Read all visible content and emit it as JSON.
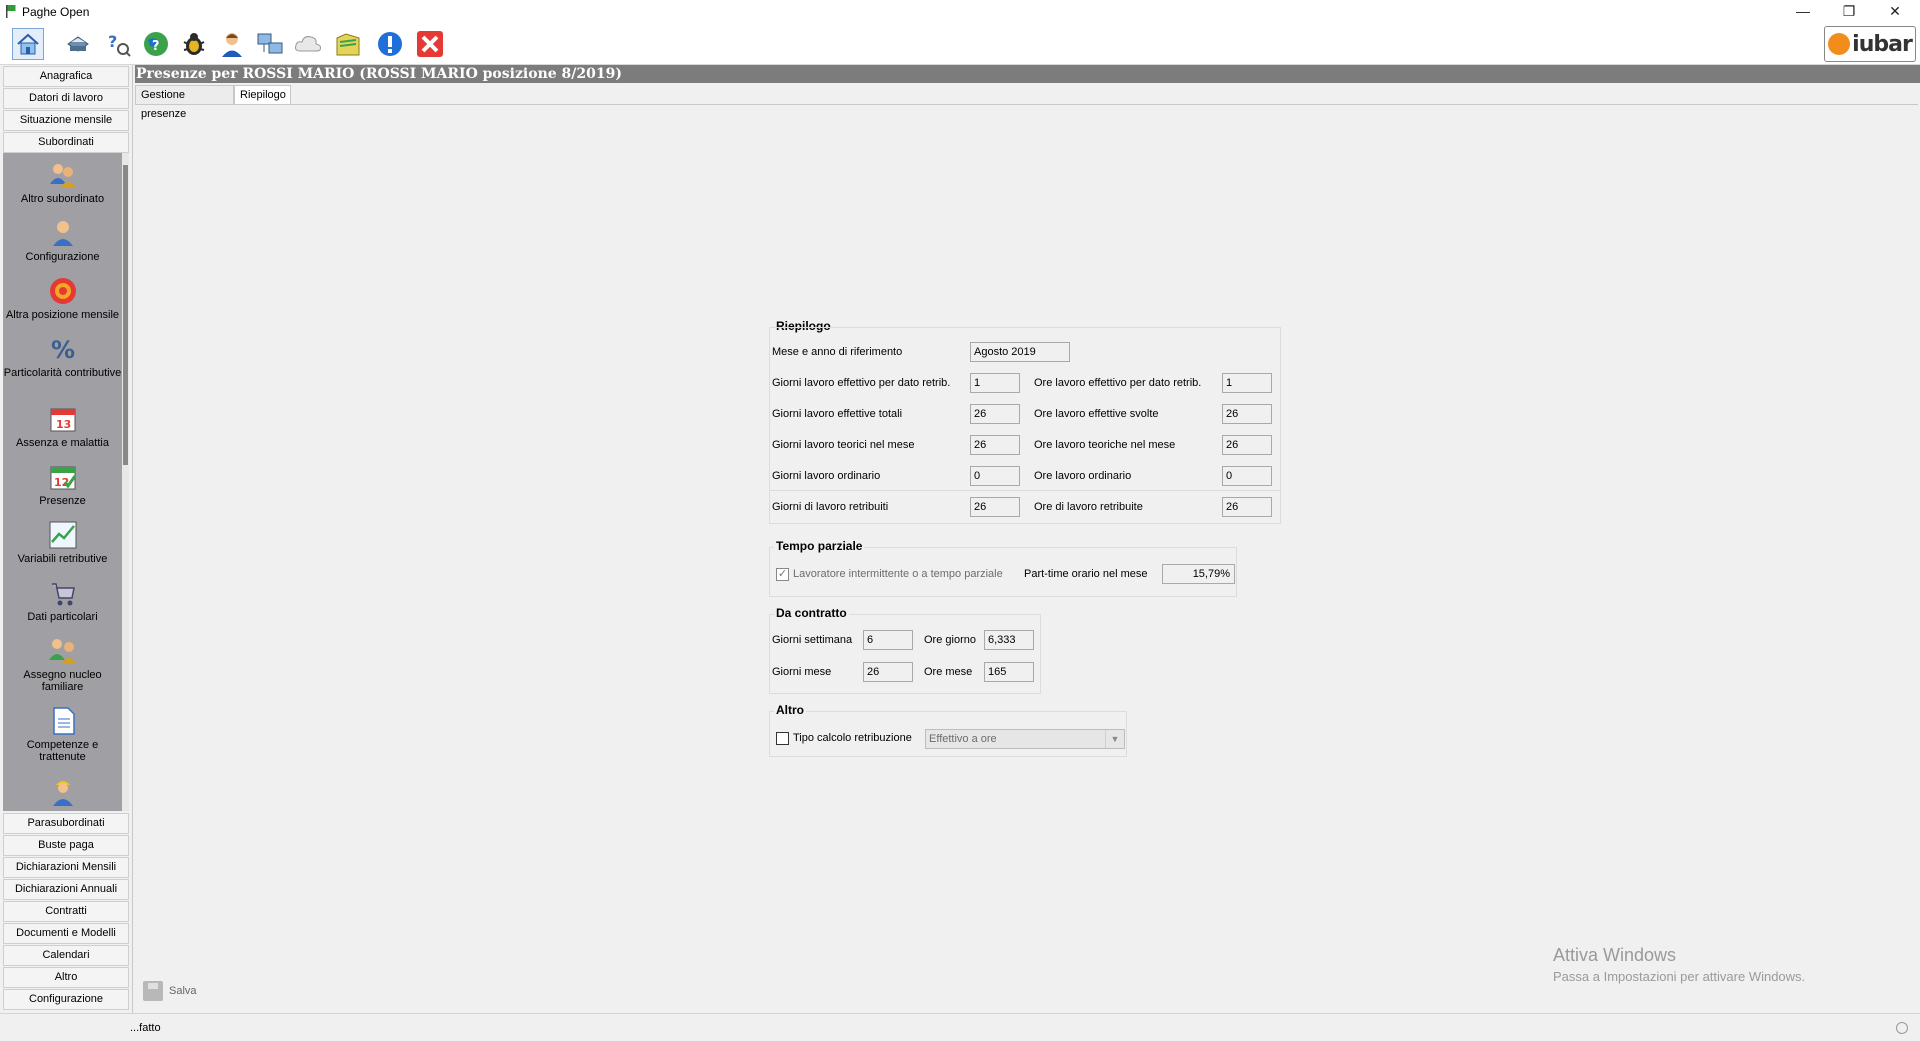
{
  "window": {
    "title": "Paghe Open",
    "controls": [
      "—",
      "❐",
      "✕"
    ]
  },
  "toolbar": {
    "logo_text": "iubar"
  },
  "sidebar": {
    "top_headers": [
      "Anagrafica",
      "Datori di lavoro",
      "Situazione mensile",
      "Subordinati"
    ],
    "items": [
      "Altro subordinato",
      "Configurazione",
      "Altra posizione mensile",
      "Particolarità contributive",
      "Assenza e malattia",
      "Presenze",
      "Variabili retributive",
      "Dati particolari",
      "Assegno nucleo familiare",
      "Competenze e trattenute"
    ],
    "bottom_headers": [
      "Parasubordinati",
      "Buste paga",
      "Dichiarazioni Mensili",
      "Dichiarazioni Annuali",
      "Contratti",
      "Documenti e Modelli",
      "Calendari",
      "Altro",
      "Configurazione"
    ]
  },
  "main": {
    "title": "Presenze per ROSSI MARIO (ROSSI MARIO posizione 8/2019)",
    "tabs": [
      "Gestione presenze",
      "Riepilogo"
    ],
    "active_tab": "Riepilogo",
    "riepilogo": {
      "title": "Riepilogo",
      "mese_label": "Mese e anno di riferimento",
      "mese_value": "Agosto 2019",
      "rows": [
        {
          "left_label": "Giorni lavoro effettivo per dato retrib.",
          "left_value": "1",
          "right_label": "Ore lavoro effettivo per dato retrib.",
          "right_value": "1"
        },
        {
          "left_label": "Giorni lavoro effettive totali",
          "left_value": "26",
          "right_label": "Ore lavoro effettive svolte",
          "right_value": "26"
        },
        {
          "left_label": "Giorni lavoro teorici nel mese",
          "left_value": "26",
          "right_label": "Ore lavoro teoriche nel mese",
          "right_value": "26"
        },
        {
          "left_label": "Giorni lavoro ordinario",
          "left_value": "0",
          "right_label": "Ore lavoro ordinario",
          "right_value": "0"
        },
        {
          "left_label": "Giorni di lavoro retribuiti",
          "left_value": "26",
          "right_label": "Ore di lavoro retribuite",
          "right_value": "26"
        }
      ]
    },
    "tempo_parziale": {
      "title": "Tempo parziale",
      "checkbox_label": "Lavoratore intermittente o a tempo parziale",
      "checkbox_mark": "✓",
      "pt_label": "Part-time orario nel mese",
      "pt_value": "15,79%"
    },
    "da_contratto": {
      "title": "Da contratto",
      "giorni_settimana_label": "Giorni settimana",
      "giorni_settimana_value": "6",
      "ore_giorno_label": "Ore giorno",
      "ore_giorno_value": "6,333",
      "giorni_mese_label": "Giorni mese",
      "giorni_mese_value": "26",
      "ore_mese_label": "Ore mese",
      "ore_mese_value": "165"
    },
    "altro": {
      "title": "Altro",
      "checkbox_label": "Tipo calcolo retribuzione",
      "combo_value": "Effettivo a ore"
    },
    "save_label": "Salva"
  },
  "watermark": {
    "line1": "Attiva Windows",
    "line2": "Passa a Impostazioni per attivare Windows."
  },
  "status": {
    "message": "...fatto"
  },
  "colors": {
    "title_bar": "#7c7c7c",
    "sidebar_panel": "#a0a0a4",
    "accent_red": "#e53935",
    "accent_blue": "#1e6fd9"
  }
}
